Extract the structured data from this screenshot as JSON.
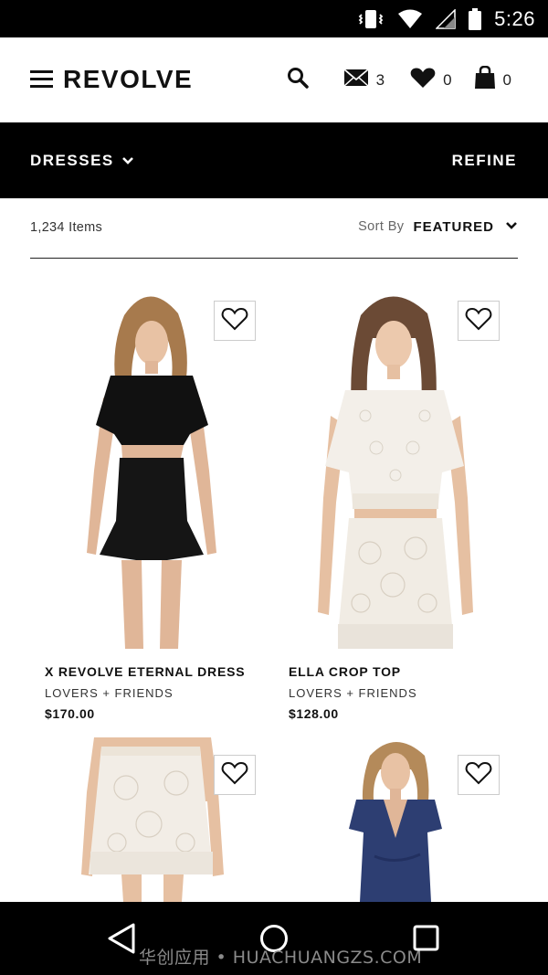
{
  "status_bar": {
    "time": "5:26",
    "icons": [
      "vibrate-icon",
      "wifi-icon",
      "signal-icon",
      "battery-icon"
    ]
  },
  "header": {
    "logo": "REVOLVE",
    "menu_icon": "hamburger-menu-icon",
    "search_icon": "search-icon",
    "messages": {
      "icon": "envelope-icon",
      "count": "3"
    },
    "wishlist": {
      "icon": "heart-icon",
      "count": "0"
    },
    "bag": {
      "icon": "shopping-bag-icon",
      "count": "0"
    }
  },
  "category_bar": {
    "category": "DRESSES",
    "refine_label": "REFINE"
  },
  "results": {
    "items_count": "1,234 Items",
    "sort_label": "Sort By",
    "sort_value": "FEATURED"
  },
  "products": [
    {
      "name": "X REVOLVE ETERNAL DRESS",
      "brand": "LOVERS + FRIENDS",
      "price": "$170.00",
      "image": "black-cutout-dress-model"
    },
    {
      "name": "ELLA CROP TOP",
      "brand": "LOVERS + FRIENDS",
      "price": "$128.00",
      "image": "white-lace-crop-top-model"
    },
    {
      "name": "",
      "brand": "",
      "price": "",
      "image": "white-lace-skirt-model"
    },
    {
      "name": "",
      "brand": "",
      "price": "",
      "image": "navy-wrap-dress-model"
    }
  ],
  "watermark": "华创应用 • HUACHUANGZS.COM",
  "colors": {
    "bar_background": "#000000",
    "text_primary": "#111111",
    "wish_border": "#cccccc"
  }
}
